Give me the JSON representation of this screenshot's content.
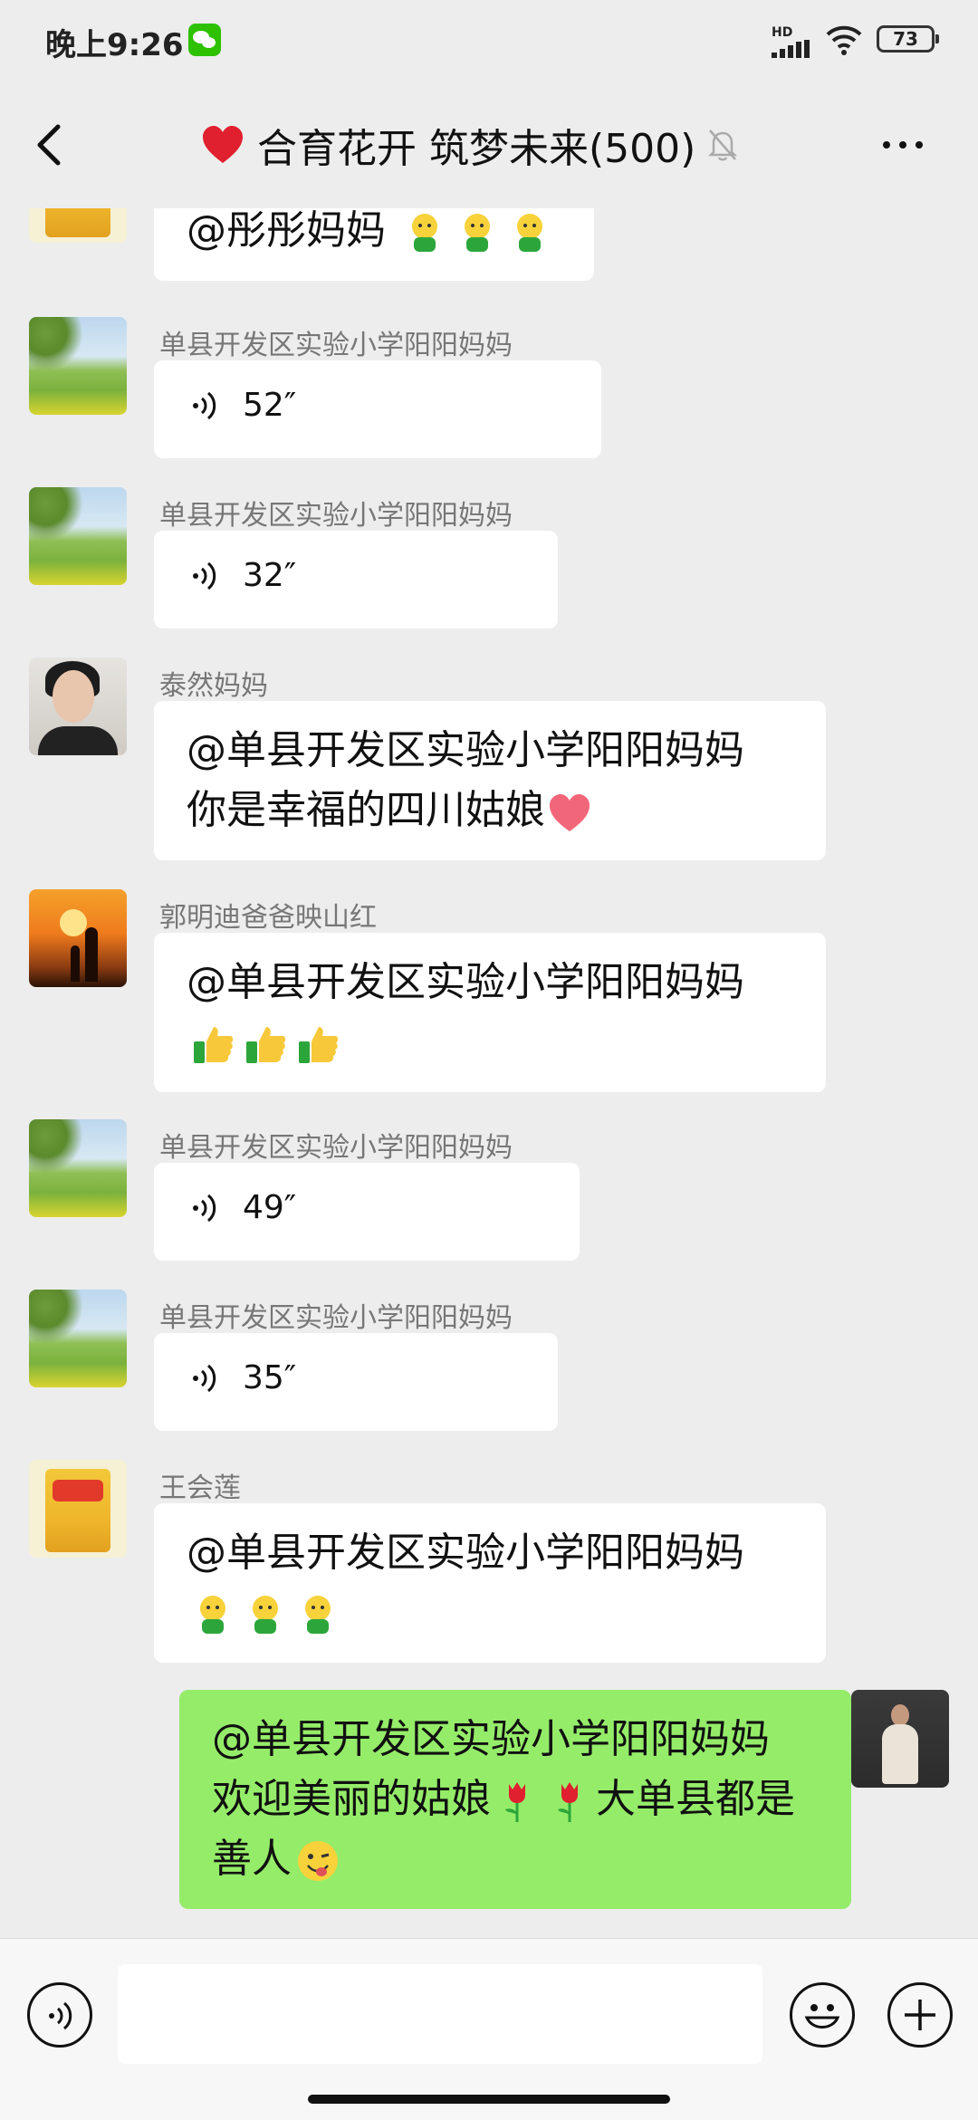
{
  "status": {
    "time": "晚上9:26",
    "hd_label": "HD",
    "battery": "73"
  },
  "header": {
    "title": "合育花开 筑梦未来(500)"
  },
  "messages": [
    {
      "sender": "",
      "text": "@彤彤妈妈"
    },
    {
      "sender": "单县开发区实验小学阳阳妈妈",
      "voice_duration": "52″"
    },
    {
      "sender": "单县开发区实验小学阳阳妈妈",
      "voice_duration": "32″"
    },
    {
      "sender": "泰然妈妈",
      "text_line1": "@单县开发区实验小学阳阳妈妈",
      "text_line2": "你是幸福的四川姑娘"
    },
    {
      "sender": "郭明迪爸爸映山红",
      "text_line1": "@单县开发区实验小学阳阳妈妈"
    },
    {
      "sender": "单县开发区实验小学阳阳妈妈",
      "voice_duration": "49″"
    },
    {
      "sender": "单县开发区实验小学阳阳妈妈",
      "voice_duration": "35″"
    },
    {
      "sender": "王会莲",
      "text_line1": "@单县开发区实验小学阳阳妈妈"
    },
    {
      "sender": "",
      "text_line1": "@单县开发区实验小学阳阳妈妈",
      "text_line2": "欢迎美丽的姑娘",
      "text_line2b": "大单县都是",
      "text_line3": "善人"
    }
  ],
  "colors": {
    "background": "#ededed",
    "my_bubble": "#95ec69",
    "other_bubble": "#ffffff"
  }
}
